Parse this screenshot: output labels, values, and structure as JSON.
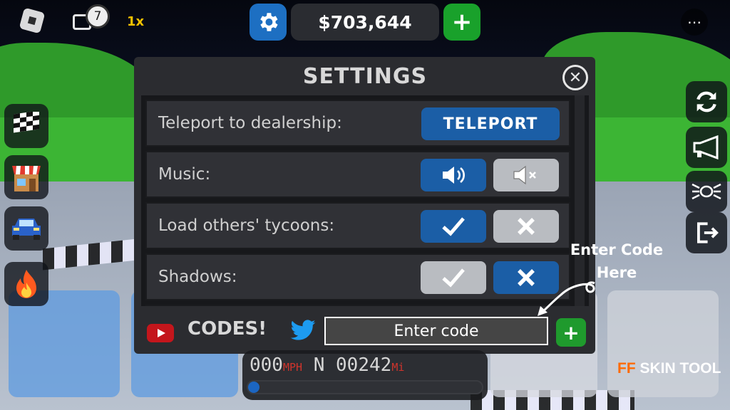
{
  "topbar": {
    "chat_count": "7",
    "speed_multiplier": "1x",
    "money": "$703,644",
    "add_money_label": "+",
    "more_label": "⋯"
  },
  "settings": {
    "title": "SETTINGS",
    "close_label": "✕",
    "rows": [
      {
        "label": "Teleport to dealership:",
        "button": "TELEPORT"
      },
      {
        "label": "Music:",
        "on_icon": "speaker-on-icon",
        "off_icon": "speaker-muted-icon",
        "state": "on"
      },
      {
        "label": "Load others' tycoons:",
        "on_icon": "checkmark-icon",
        "off_icon": "x-icon",
        "state": "on"
      },
      {
        "label": "Shadows:",
        "on_icon": "checkmark-icon",
        "off_icon": "x-icon",
        "state": "off"
      }
    ],
    "codes_label": "CODES!",
    "code_placeholder": "Enter code",
    "redeem_label": "+"
  },
  "annotation": {
    "line1": "Enter Code",
    "line2": "Here"
  },
  "speedometer": {
    "speed": "000",
    "speed_unit": "MPH",
    "gear": "N",
    "odometer": "00242",
    "odometer_unit": "Mi",
    "progress": 0.05
  },
  "watermark": {
    "brand": "FF",
    "text": "SKIN TOOL"
  },
  "colors": {
    "accent_blue": "#1b5ea6",
    "inactive_gray": "#b9bcc1",
    "green": "#19a12b",
    "money_bg": "#2a2c31"
  },
  "icons": [
    "roblox-logo-icon",
    "chat-icon",
    "gear-icon",
    "checkered-flag-icon",
    "shop-icon",
    "car-icon",
    "fire-icon",
    "refresh-icon",
    "horn-icon",
    "headlights-icon",
    "exit-icon",
    "youtube-icon",
    "twitter-icon"
  ]
}
